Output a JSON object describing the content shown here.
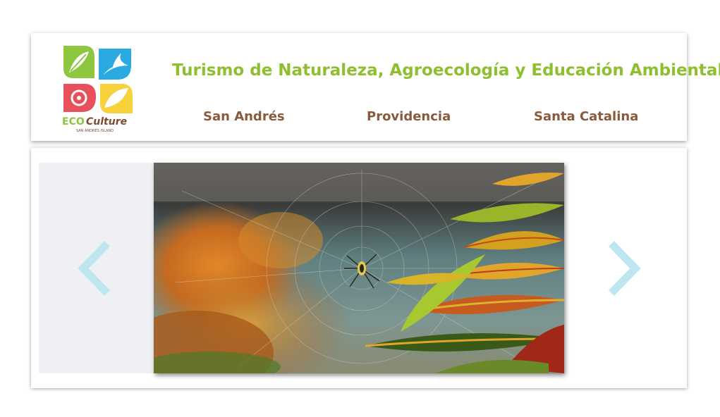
{
  "header": {
    "site_title": "Turismo de Naturaleza, Agroecología y Educación Ambiental",
    "logo": {
      "brand_eco": "ECO",
      "brand_culture": "Culture",
      "tagline": "SAN ANDRÉS ISLAND"
    },
    "nav": [
      {
        "label": "San Andrés"
      },
      {
        "label": "Providencia"
      },
      {
        "label": "Santa Catalina"
      }
    ]
  },
  "slider": {
    "prev_icon": "chevron-left-icon",
    "next_icon": "chevron-right-icon",
    "image_subject": "spider-web-photo"
  },
  "colors": {
    "title_green": "#8dbf2f",
    "nav_brown": "#8a5a3c",
    "arrow_blue": "#bde6f0",
    "logo_green": "#8dc63f",
    "logo_blue": "#29abe2",
    "logo_red": "#e8505b",
    "logo_yellow": "#f7d23c"
  }
}
